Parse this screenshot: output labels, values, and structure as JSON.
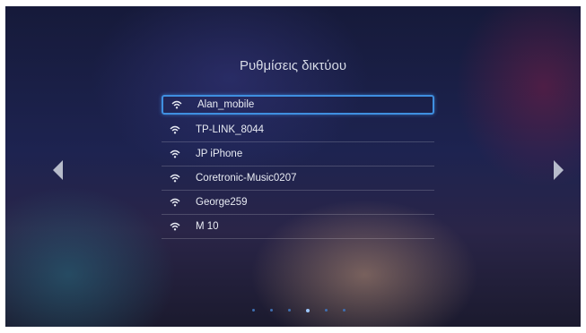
{
  "title": "Ρυθμίσεις δικτύου",
  "networks": [
    {
      "ssid": "Alan_mobile",
      "icon": "wifi-signal-icon",
      "selected": true
    },
    {
      "ssid": "TP-LINK_8044",
      "icon": "wifi-signal-icon",
      "selected": false
    },
    {
      "ssid": "JP iPhone",
      "icon": "wifi-signal-icon",
      "selected": false
    },
    {
      "ssid": "Coretronic-Music0207",
      "icon": "wifi-signal-icon",
      "selected": false
    },
    {
      "ssid": "George259",
      "icon": "wifi-signal-icon",
      "selected": false
    },
    {
      "ssid": "M 10",
      "icon": "wifi-signal-icon",
      "selected": false
    }
  ],
  "pagination": {
    "total_pages": 6,
    "current_page": 4
  },
  "colors": {
    "selection": "#3f8fe0",
    "text": "#e8ebf3",
    "arrow": "#b7bccb"
  }
}
